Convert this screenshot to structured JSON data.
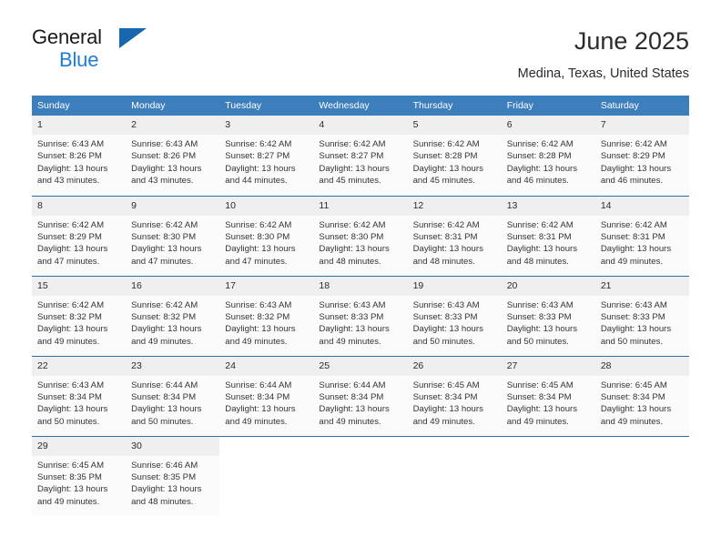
{
  "brand": {
    "name_top": "General",
    "name_bottom": "Blue",
    "triangle_icon": "triangle-logo-icon",
    "color_top": "#1a1a1a",
    "color_bottom": "#1c7fd6"
  },
  "header": {
    "title": "June 2025",
    "subtitle": "Medina, Texas, United States"
  },
  "theme": {
    "header_bg": "#3d7ebd",
    "row_divider": "#2f6fae",
    "daynum_bg": "#efefef",
    "cell_bg": "#fbfbfb"
  },
  "calendar": {
    "weekday_headers": [
      "Sunday",
      "Monday",
      "Tuesday",
      "Wednesday",
      "Thursday",
      "Friday",
      "Saturday"
    ],
    "weeks": [
      [
        {
          "day": "1",
          "sunrise": "Sunrise: 6:43 AM",
          "sunset": "Sunset: 8:26 PM",
          "daylight_line1": "Daylight: 13 hours",
          "daylight_line2": "and 43 minutes."
        },
        {
          "day": "2",
          "sunrise": "Sunrise: 6:43 AM",
          "sunset": "Sunset: 8:26 PM",
          "daylight_line1": "Daylight: 13 hours",
          "daylight_line2": "and 43 minutes."
        },
        {
          "day": "3",
          "sunrise": "Sunrise: 6:42 AM",
          "sunset": "Sunset: 8:27 PM",
          "daylight_line1": "Daylight: 13 hours",
          "daylight_line2": "and 44 minutes."
        },
        {
          "day": "4",
          "sunrise": "Sunrise: 6:42 AM",
          "sunset": "Sunset: 8:27 PM",
          "daylight_line1": "Daylight: 13 hours",
          "daylight_line2": "and 45 minutes."
        },
        {
          "day": "5",
          "sunrise": "Sunrise: 6:42 AM",
          "sunset": "Sunset: 8:28 PM",
          "daylight_line1": "Daylight: 13 hours",
          "daylight_line2": "and 45 minutes."
        },
        {
          "day": "6",
          "sunrise": "Sunrise: 6:42 AM",
          "sunset": "Sunset: 8:28 PM",
          "daylight_line1": "Daylight: 13 hours",
          "daylight_line2": "and 46 minutes."
        },
        {
          "day": "7",
          "sunrise": "Sunrise: 6:42 AM",
          "sunset": "Sunset: 8:29 PM",
          "daylight_line1": "Daylight: 13 hours",
          "daylight_line2": "and 46 minutes."
        }
      ],
      [
        {
          "day": "8",
          "sunrise": "Sunrise: 6:42 AM",
          "sunset": "Sunset: 8:29 PM",
          "daylight_line1": "Daylight: 13 hours",
          "daylight_line2": "and 47 minutes."
        },
        {
          "day": "9",
          "sunrise": "Sunrise: 6:42 AM",
          "sunset": "Sunset: 8:30 PM",
          "daylight_line1": "Daylight: 13 hours",
          "daylight_line2": "and 47 minutes."
        },
        {
          "day": "10",
          "sunrise": "Sunrise: 6:42 AM",
          "sunset": "Sunset: 8:30 PM",
          "daylight_line1": "Daylight: 13 hours",
          "daylight_line2": "and 47 minutes."
        },
        {
          "day": "11",
          "sunrise": "Sunrise: 6:42 AM",
          "sunset": "Sunset: 8:30 PM",
          "daylight_line1": "Daylight: 13 hours",
          "daylight_line2": "and 48 minutes."
        },
        {
          "day": "12",
          "sunrise": "Sunrise: 6:42 AM",
          "sunset": "Sunset: 8:31 PM",
          "daylight_line1": "Daylight: 13 hours",
          "daylight_line2": "and 48 minutes."
        },
        {
          "day": "13",
          "sunrise": "Sunrise: 6:42 AM",
          "sunset": "Sunset: 8:31 PM",
          "daylight_line1": "Daylight: 13 hours",
          "daylight_line2": "and 48 minutes."
        },
        {
          "day": "14",
          "sunrise": "Sunrise: 6:42 AM",
          "sunset": "Sunset: 8:31 PM",
          "daylight_line1": "Daylight: 13 hours",
          "daylight_line2": "and 49 minutes."
        }
      ],
      [
        {
          "day": "15",
          "sunrise": "Sunrise: 6:42 AM",
          "sunset": "Sunset: 8:32 PM",
          "daylight_line1": "Daylight: 13 hours",
          "daylight_line2": "and 49 minutes."
        },
        {
          "day": "16",
          "sunrise": "Sunrise: 6:42 AM",
          "sunset": "Sunset: 8:32 PM",
          "daylight_line1": "Daylight: 13 hours",
          "daylight_line2": "and 49 minutes."
        },
        {
          "day": "17",
          "sunrise": "Sunrise: 6:43 AM",
          "sunset": "Sunset: 8:32 PM",
          "daylight_line1": "Daylight: 13 hours",
          "daylight_line2": "and 49 minutes."
        },
        {
          "day": "18",
          "sunrise": "Sunrise: 6:43 AM",
          "sunset": "Sunset: 8:33 PM",
          "daylight_line1": "Daylight: 13 hours",
          "daylight_line2": "and 49 minutes."
        },
        {
          "day": "19",
          "sunrise": "Sunrise: 6:43 AM",
          "sunset": "Sunset: 8:33 PM",
          "daylight_line1": "Daylight: 13 hours",
          "daylight_line2": "and 50 minutes."
        },
        {
          "day": "20",
          "sunrise": "Sunrise: 6:43 AM",
          "sunset": "Sunset: 8:33 PM",
          "daylight_line1": "Daylight: 13 hours",
          "daylight_line2": "and 50 minutes."
        },
        {
          "day": "21",
          "sunrise": "Sunrise: 6:43 AM",
          "sunset": "Sunset: 8:33 PM",
          "daylight_line1": "Daylight: 13 hours",
          "daylight_line2": "and 50 minutes."
        }
      ],
      [
        {
          "day": "22",
          "sunrise": "Sunrise: 6:43 AM",
          "sunset": "Sunset: 8:34 PM",
          "daylight_line1": "Daylight: 13 hours",
          "daylight_line2": "and 50 minutes."
        },
        {
          "day": "23",
          "sunrise": "Sunrise: 6:44 AM",
          "sunset": "Sunset: 8:34 PM",
          "daylight_line1": "Daylight: 13 hours",
          "daylight_line2": "and 50 minutes."
        },
        {
          "day": "24",
          "sunrise": "Sunrise: 6:44 AM",
          "sunset": "Sunset: 8:34 PM",
          "daylight_line1": "Daylight: 13 hours",
          "daylight_line2": "and 49 minutes."
        },
        {
          "day": "25",
          "sunrise": "Sunrise: 6:44 AM",
          "sunset": "Sunset: 8:34 PM",
          "daylight_line1": "Daylight: 13 hours",
          "daylight_line2": "and 49 minutes."
        },
        {
          "day": "26",
          "sunrise": "Sunrise: 6:45 AM",
          "sunset": "Sunset: 8:34 PM",
          "daylight_line1": "Daylight: 13 hours",
          "daylight_line2": "and 49 minutes."
        },
        {
          "day": "27",
          "sunrise": "Sunrise: 6:45 AM",
          "sunset": "Sunset: 8:34 PM",
          "daylight_line1": "Daylight: 13 hours",
          "daylight_line2": "and 49 minutes."
        },
        {
          "day": "28",
          "sunrise": "Sunrise: 6:45 AM",
          "sunset": "Sunset: 8:34 PM",
          "daylight_line1": "Daylight: 13 hours",
          "daylight_line2": "and 49 minutes."
        }
      ],
      [
        {
          "day": "29",
          "sunrise": "Sunrise: 6:45 AM",
          "sunset": "Sunset: 8:35 PM",
          "daylight_line1": "Daylight: 13 hours",
          "daylight_line2": "and 49 minutes."
        },
        {
          "day": "30",
          "sunrise": "Sunrise: 6:46 AM",
          "sunset": "Sunset: 8:35 PM",
          "daylight_line1": "Daylight: 13 hours",
          "daylight_line2": "and 48 minutes."
        },
        {
          "day": "",
          "sunrise": "",
          "sunset": "",
          "daylight_line1": "",
          "daylight_line2": ""
        },
        {
          "day": "",
          "sunrise": "",
          "sunset": "",
          "daylight_line1": "",
          "daylight_line2": ""
        },
        {
          "day": "",
          "sunrise": "",
          "sunset": "",
          "daylight_line1": "",
          "daylight_line2": ""
        },
        {
          "day": "",
          "sunrise": "",
          "sunset": "",
          "daylight_line1": "",
          "daylight_line2": ""
        },
        {
          "day": "",
          "sunrise": "",
          "sunset": "",
          "daylight_line1": "",
          "daylight_line2": ""
        }
      ]
    ]
  }
}
